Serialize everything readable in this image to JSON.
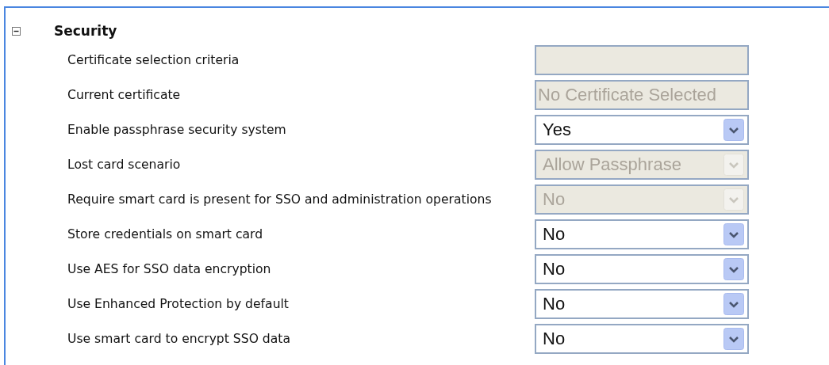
{
  "section": {
    "title": "Security",
    "expanded": true,
    "rows": [
      {
        "label": "Certificate selection criteria",
        "kind": "text",
        "value": "",
        "disabled": true
      },
      {
        "label": "Current certificate",
        "kind": "text",
        "value": "No Certificate Selected",
        "disabled": true
      },
      {
        "label": "Enable passphrase security system",
        "kind": "select",
        "value": "Yes",
        "disabled": false
      },
      {
        "label": "Lost card scenario",
        "kind": "select",
        "value": "Allow Passphrase",
        "disabled": true
      },
      {
        "label": "Require smart card is present for SSO and administration operations",
        "kind": "select",
        "value": "No",
        "disabled": true
      },
      {
        "label": "Store credentials on smart card",
        "kind": "select",
        "value": "No",
        "disabled": false
      },
      {
        "label": "Use AES for SSO data encryption",
        "kind": "select",
        "value": "No",
        "disabled": false
      },
      {
        "label": "Use Enhanced Protection by default",
        "kind": "select",
        "value": "No",
        "disabled": false
      },
      {
        "label": "Use smart card to encrypt SSO data",
        "kind": "select",
        "value": "No",
        "disabled": false
      }
    ]
  }
}
